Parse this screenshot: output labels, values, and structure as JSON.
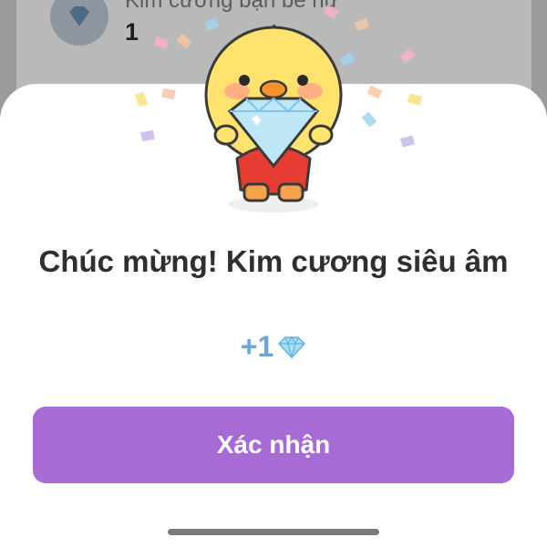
{
  "background": {
    "label": "Kim cương bạn bè nữ",
    "count": "1"
  },
  "dialog": {
    "title": "Chúc mừng! Kim cương siêu âm",
    "reward_amount": "+1",
    "reward_icon": "diamond-icon",
    "confirm_label": "Xác nhận"
  },
  "colors": {
    "accent": "#a86bd6",
    "reward": "#6aa6d8",
    "title": "#2f2f2f"
  }
}
